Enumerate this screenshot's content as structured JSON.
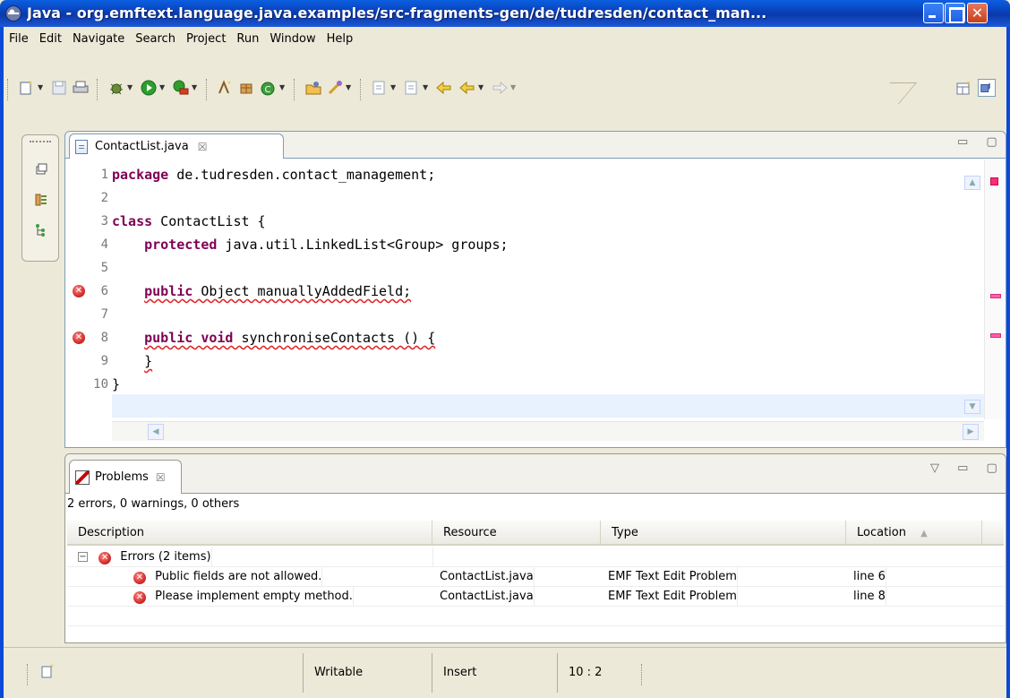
{
  "window": {
    "title": "Java - org.emftext.language.java.examples/src-fragments-gen/de/tudresden/contact_man...",
    "close_glyph": "✕"
  },
  "menu": [
    "File",
    "Edit",
    "Navigate",
    "Search",
    "Project",
    "Run",
    "Window",
    "Help"
  ],
  "editor": {
    "tab_label": "ContactList.java",
    "tab_close": "☒",
    "view_controls": "▭ ▢",
    "lines": [
      {
        "n": "1",
        "segments": [
          {
            "t": "package",
            "kw": true
          },
          {
            "t": " de.tudresden.contact_management;"
          }
        ]
      },
      {
        "n": "2",
        "segments": []
      },
      {
        "n": "3",
        "segments": [
          {
            "t": "class",
            "kw": true
          },
          {
            "t": " ContactList {"
          }
        ]
      },
      {
        "n": "4",
        "segments": [
          {
            "t": "    "
          },
          {
            "t": "protected",
            "kw": true
          },
          {
            "t": " java.util.LinkedList<Group> groups;"
          }
        ]
      },
      {
        "n": "5",
        "segments": []
      },
      {
        "n": "6",
        "error": true,
        "segments": [
          {
            "t": "    "
          },
          {
            "t": "public",
            "kw": true,
            "squig": true
          },
          {
            "t": " Object manuallyAddedField;",
            "squig": true
          }
        ]
      },
      {
        "n": "7",
        "segments": []
      },
      {
        "n": "8",
        "error": true,
        "segments": [
          {
            "t": "    "
          },
          {
            "t": "public",
            "kw": true,
            "squig": true
          },
          {
            "t": " ",
            "squig": true
          },
          {
            "t": "void",
            "kw": true,
            "squig": true
          },
          {
            "t": " synchroniseContacts () {",
            "squig": true
          }
        ]
      },
      {
        "n": "9",
        "segments": [
          {
            "t": "    "
          },
          {
            "t": "}",
            "squig": true
          }
        ]
      },
      {
        "n": "10",
        "segments": [
          {
            "t": "}"
          }
        ]
      }
    ]
  },
  "problems": {
    "tab_label": "Problems",
    "tab_close": "☒",
    "view_controls": "▽ ▭ ▢",
    "summary": "2 errors, 0 warnings, 0 others",
    "columns": {
      "description": "Description",
      "resource": "Resource",
      "type": "Type",
      "location": "Location"
    },
    "sort_indicator": "▲",
    "group": {
      "toggle": "−",
      "label": "Errors (2 items)"
    },
    "rows": [
      {
        "description": "Public fields are not allowed.",
        "resource": "ContactList.java",
        "type": "EMF Text Edit Problem",
        "location": "line 6"
      },
      {
        "description": "Please implement empty method.",
        "resource": "ContactList.java",
        "type": "EMF Text Edit Problem",
        "location": "line 8"
      }
    ]
  },
  "status": {
    "writable": "Writable",
    "insert": "Insert",
    "position": "10 : 2"
  },
  "error_glyph": "✕",
  "colors": {
    "keyword": "#7f0055",
    "error": "#d32f2f",
    "title_bar": "#0a3fb8",
    "current_line": "#e8f2fe"
  }
}
